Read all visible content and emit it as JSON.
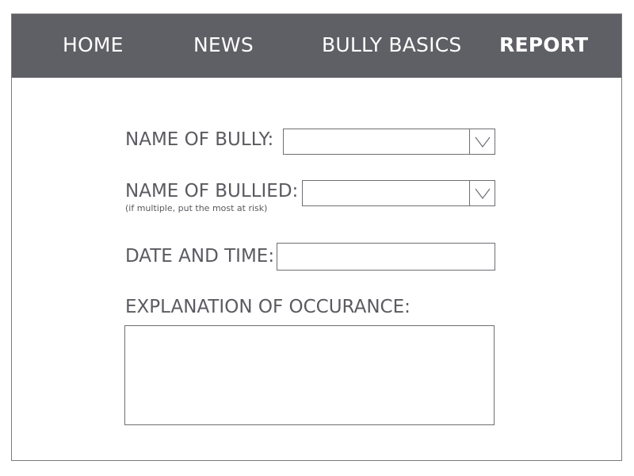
{
  "nav": {
    "items": [
      {
        "label": "HOME",
        "active": false
      },
      {
        "label": "NEWS",
        "active": false
      },
      {
        "label": "BULLY BASICS",
        "active": false
      },
      {
        "label": "REPORT",
        "active": true
      }
    ]
  },
  "form": {
    "bully_name": {
      "label": "NAME OF BULLY:",
      "value": "",
      "arrow_icon": "chevron-down-icon"
    },
    "bullied_name": {
      "label": "NAME OF BULLIED:",
      "hint": "(if multiple, put the most at risk)",
      "value": "",
      "arrow_icon": "chevron-down-icon"
    },
    "date_time": {
      "label": "DATE AND TIME:",
      "value": "",
      "placeholder": ""
    },
    "explanation": {
      "label": "EXPLANATION OF OCCURANCE:",
      "value": "",
      "placeholder": ""
    }
  },
  "colors": {
    "navbar_bg": "#5f5f66",
    "nav_text": "#ffffff",
    "label_text": "#5a5a60",
    "border": "#6e6e74"
  }
}
